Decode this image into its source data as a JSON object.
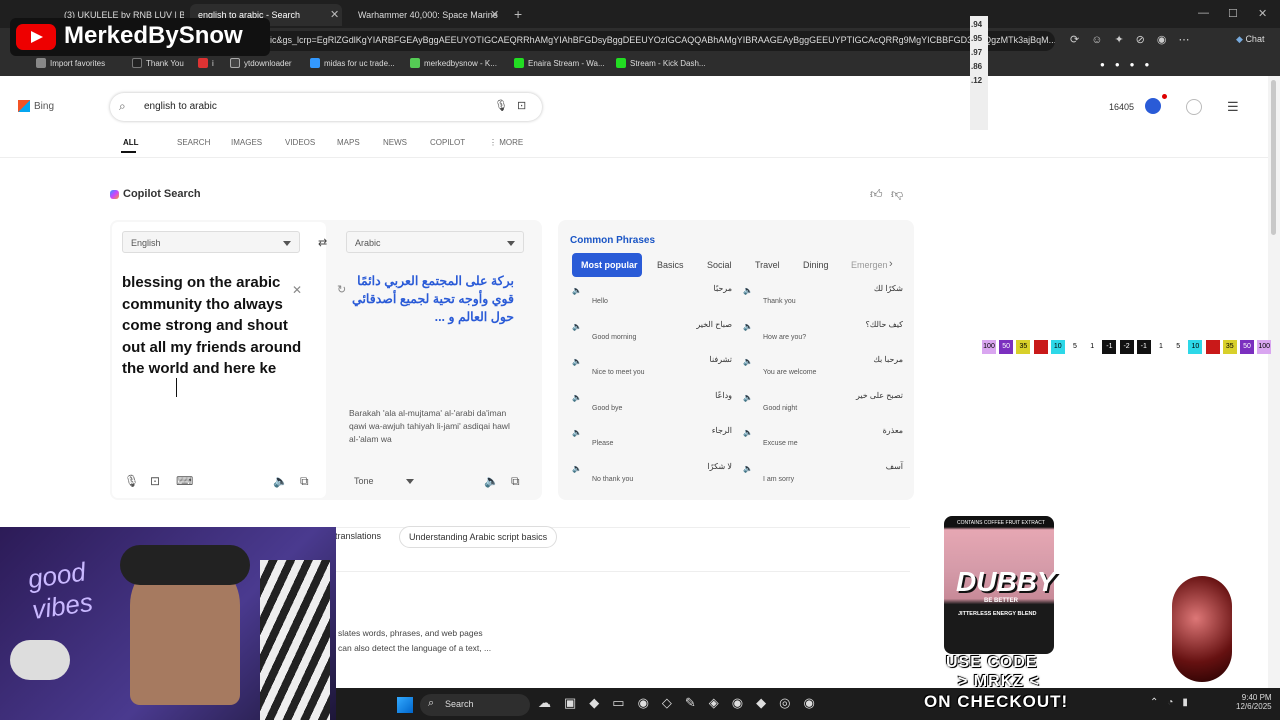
{
  "tabs": [
    {
      "label": "(3) UKULELE by RNB LUV | Ba"
    },
    {
      "label": "english to arabic - Search"
    },
    {
      "label": "Warhammer 40,000: Space Marine"
    }
  ],
  "url": "bic&gs_lcrp=EgRlZGdlKgYIARBFGEAyBggAEEUYOTIGCAEQRRhAMgYIAhBFGDsyBggDEEUYOzIGCAQQABhAMgYIBRAAGEAyBggGEEUYPTIGCAcQRRg9MgYICBBFGD3SAQgzMTk3ajBqM...",
  "favorites": [
    "Import favorites",
    "Thank You",
    "i",
    "ytdownloader",
    "midas for uc trade...",
    "merkedbysnow - K...",
    "Enaira Stream - Wa...",
    "Stream - Kick Dash..."
  ],
  "chat_label": "Chat",
  "channel": "MerkedBySnow",
  "bing": {
    "logo": "Bing",
    "query": "english to arabic",
    "points": "16405",
    "nav": [
      "ALL",
      "SEARCH",
      "IMAGES",
      "VIDEOS",
      "MAPS",
      "NEWS",
      "COPILOT",
      "MORE"
    ]
  },
  "copilot_title": "Copilot Search",
  "translator": {
    "src_lang": "English",
    "tgt_lang": "Arabic",
    "src_text": "blessing on the arabic community tho always come strong and shout out all my friends around the world and here ke",
    "tgt_text": "بركة على المجتمع العربي دائمًا قوي وأوجه تحية لجميع أصدقائي حول العالم و ...",
    "translit": "Barakah 'ala al-mujtama' al-'arabi da'iman qawi wa-awjuh tahiyah li-jami' asdiqai hawl al-'alam wa",
    "tone": "Tone"
  },
  "phrases": {
    "title": "Common Phrases",
    "tabs": [
      "Most popular",
      "Basics",
      "Social",
      "Travel",
      "Dining",
      "Emergen"
    ],
    "items": [
      {
        "ar": "مرحبًا",
        "en": "Hello"
      },
      {
        "ar": "شكرًا لك",
        "en": "Thank you"
      },
      {
        "ar": "صباح الخير",
        "en": "Good morning"
      },
      {
        "ar": "كيف حالك؟",
        "en": "How are you?"
      },
      {
        "ar": "تشرفنا",
        "en": "Nice to meet you"
      },
      {
        "ar": "مرحبا بك",
        "en": "You are welcome"
      },
      {
        "ar": "وداعًا",
        "en": "Good bye"
      },
      {
        "ar": "تصبح على خير",
        "en": "Good night"
      },
      {
        "ar": "الرجاء",
        "en": "Please"
      },
      {
        "ar": "معذرة",
        "en": "Excuse me"
      },
      {
        "ar": "لا شكرًا",
        "en": "No thank you"
      },
      {
        "ar": "آسف",
        "en": "I am sorry"
      }
    ]
  },
  "chips": [
    "translations",
    "Understanding Arabic script basics"
  ],
  "body_text": [
    "slates words, phrases, and web pages",
    "can also detect the language of a text, ..."
  ],
  "overlay": {
    "badges": [
      "100",
      "50",
      "35",
      "",
      "10",
      "5",
      "1",
      "-1",
      "-2",
      "-1",
      "1",
      "5",
      "10",
      "",
      "35",
      "50",
      "100"
    ],
    "sidenums": [
      ".94",
      ".95",
      ".97",
      ".86",
      ".12"
    ],
    "promo1": "USE CODE",
    "promo2": "> MRKZ <",
    "promo3": "ON CHECKOUT!",
    "can_brand": "DUBBY",
    "can_tag": "BE BETTER",
    "can_sub": "JITTERLESS ENERGY BLEND",
    "can_top": "CONTAINS COFFEE FRUIT EXTRACT"
  },
  "taskbar": {
    "search": "Search",
    "time": "9:40 PM",
    "date": "12/6/2025"
  }
}
